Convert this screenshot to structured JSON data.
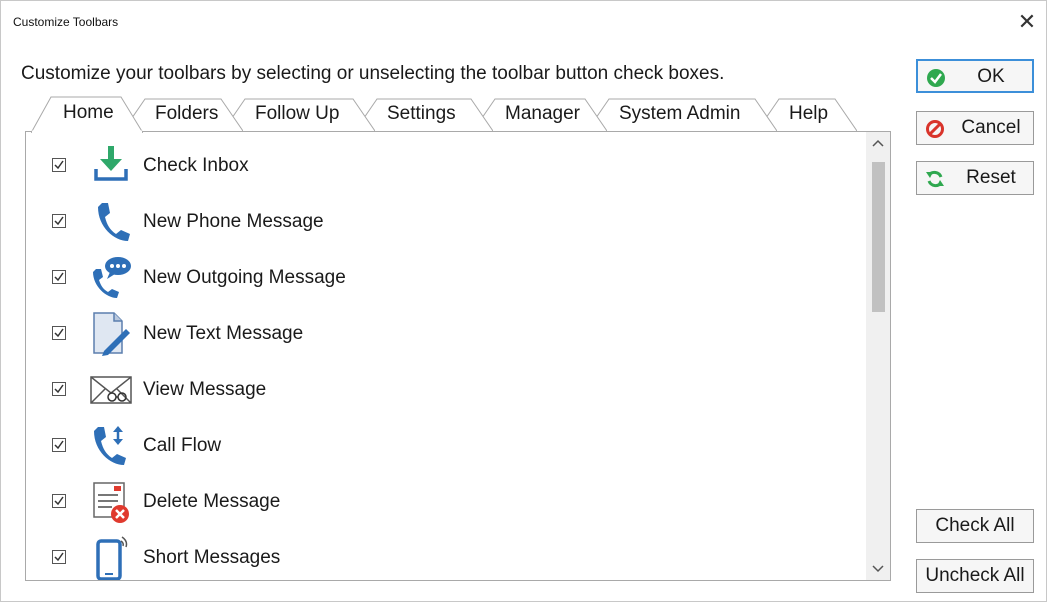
{
  "window": {
    "title": "Customize Toolbars",
    "close_glyph": "✕"
  },
  "instructions": "Customize your toolbars by selecting or unselecting the toolbar button check boxes.",
  "tabs": [
    {
      "label": "Home",
      "active": true
    },
    {
      "label": "Folders",
      "active": false
    },
    {
      "label": "Follow Up",
      "active": false
    },
    {
      "label": "Settings",
      "active": false
    },
    {
      "label": "Manager",
      "active": false
    },
    {
      "label": "System Admin",
      "active": false
    },
    {
      "label": "Help",
      "active": false
    }
  ],
  "items": [
    {
      "label": "Check Inbox",
      "checked": true,
      "icon": "download-inbox-icon"
    },
    {
      "label": "New Phone Message",
      "checked": true,
      "icon": "phone-icon"
    },
    {
      "label": "New Outgoing Message",
      "checked": true,
      "icon": "phone-speech-bubble-icon"
    },
    {
      "label": "New Text Message",
      "checked": true,
      "icon": "document-pen-icon"
    },
    {
      "label": "View Message",
      "checked": true,
      "icon": "envelope-glasses-icon"
    },
    {
      "label": "Call Flow",
      "checked": true,
      "icon": "phone-arrows-icon"
    },
    {
      "label": "Delete Message",
      "checked": true,
      "icon": "document-delete-icon"
    },
    {
      "label": "Short Messages",
      "checked": true,
      "icon": "mobile-signal-icon"
    }
  ],
  "buttons": {
    "ok": {
      "label": "OK",
      "icon": "check-circle-icon"
    },
    "cancel": {
      "label": "Cancel",
      "icon": "prohibited-icon"
    },
    "reset": {
      "label": "Reset",
      "icon": "refresh-icon"
    },
    "check_all": {
      "label": "Check All"
    },
    "uncheck_all": {
      "label": "Uncheck All"
    }
  },
  "scrollbar": {
    "up_glyph": "⌃",
    "down_glyph": "⌄"
  },
  "colors": {
    "accent_blue": "#2e6fb7",
    "ok_green": "#2fa84f",
    "cancel_red": "#d9342b",
    "reset_green": "#2fa84f",
    "inbox_green": "#2fa86a",
    "delete_red": "#e03a2e",
    "focus_border": "#3c8fd9"
  }
}
